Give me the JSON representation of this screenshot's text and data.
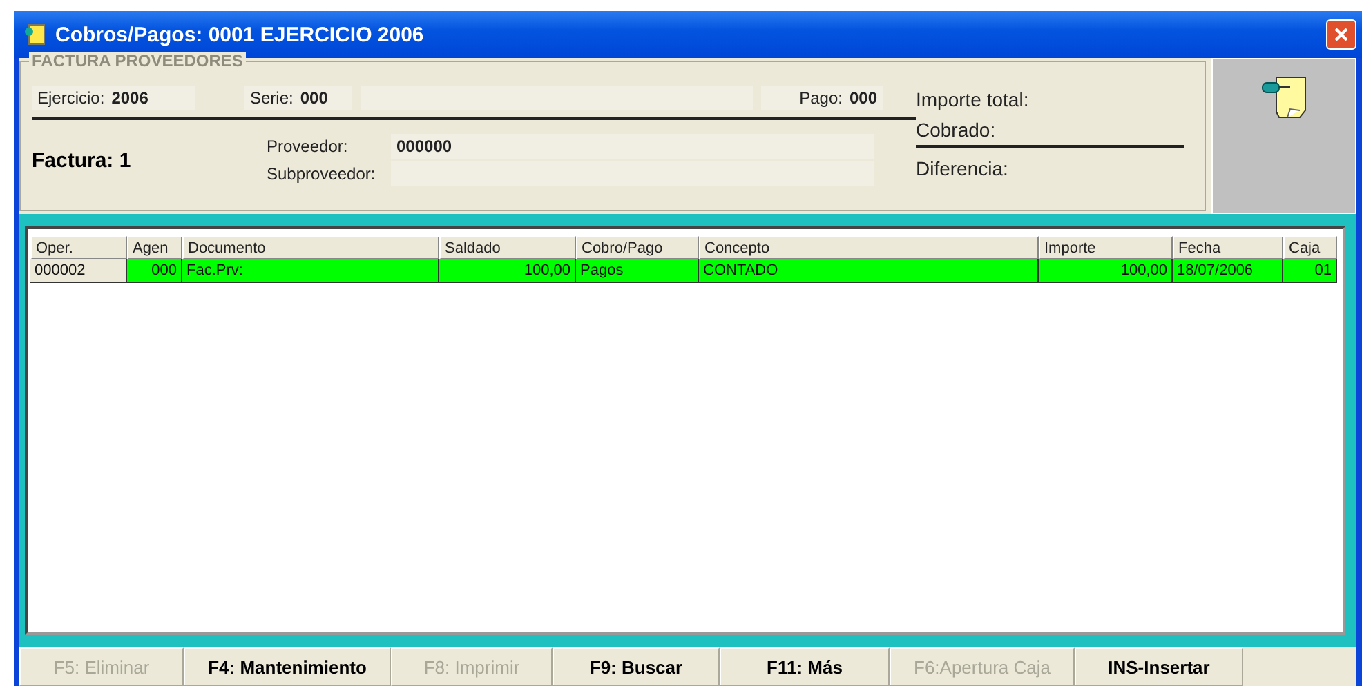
{
  "window": {
    "title": "Cobros/Pagos: 0001 EJERCICIO 2006"
  },
  "header": {
    "group_title": "FACTURA PROVEEDORES",
    "ejercicio": {
      "label": "Ejercicio:",
      "value": "2006"
    },
    "serie": {
      "label": "Serie:",
      "value": "000"
    },
    "pago": {
      "label": "Pago:",
      "value": "000"
    },
    "factura": "Factura: 1",
    "proveedor": {
      "label": "Proveedor:",
      "value": "000000"
    },
    "subproveedor": {
      "label": "Subproveedor:"
    },
    "totals": [
      "Importe total:",
      "Cobrado:",
      "Diferencia:"
    ]
  },
  "table": {
    "columns": [
      "Oper.",
      "Agen",
      "Documento",
      "Saldado",
      "Cobro/Pago",
      "Concepto",
      "Importe",
      "Fecha",
      "Caja"
    ],
    "rows": [
      {
        "selected": true,
        "cells": [
          "000002",
          "000",
          "Fac.Prv:",
          "100,00",
          "Pagos",
          "CONTADO",
          "100,00",
          "18/07/2006",
          "01"
        ]
      }
    ]
  },
  "buttons": [
    {
      "label": "F5: Eliminar",
      "disabled": true
    },
    {
      "label": "F4: Mantenimiento",
      "disabled": false
    },
    {
      "label": "F8: Imprimir",
      "disabled": true
    },
    {
      "label": "F9: Buscar",
      "disabled": false
    },
    {
      "label": "F11: Más",
      "disabled": false
    },
    {
      "label": "F6:Apertura Caja",
      "disabled": true
    },
    {
      "label": "INS-Insertar",
      "disabled": false
    }
  ]
}
